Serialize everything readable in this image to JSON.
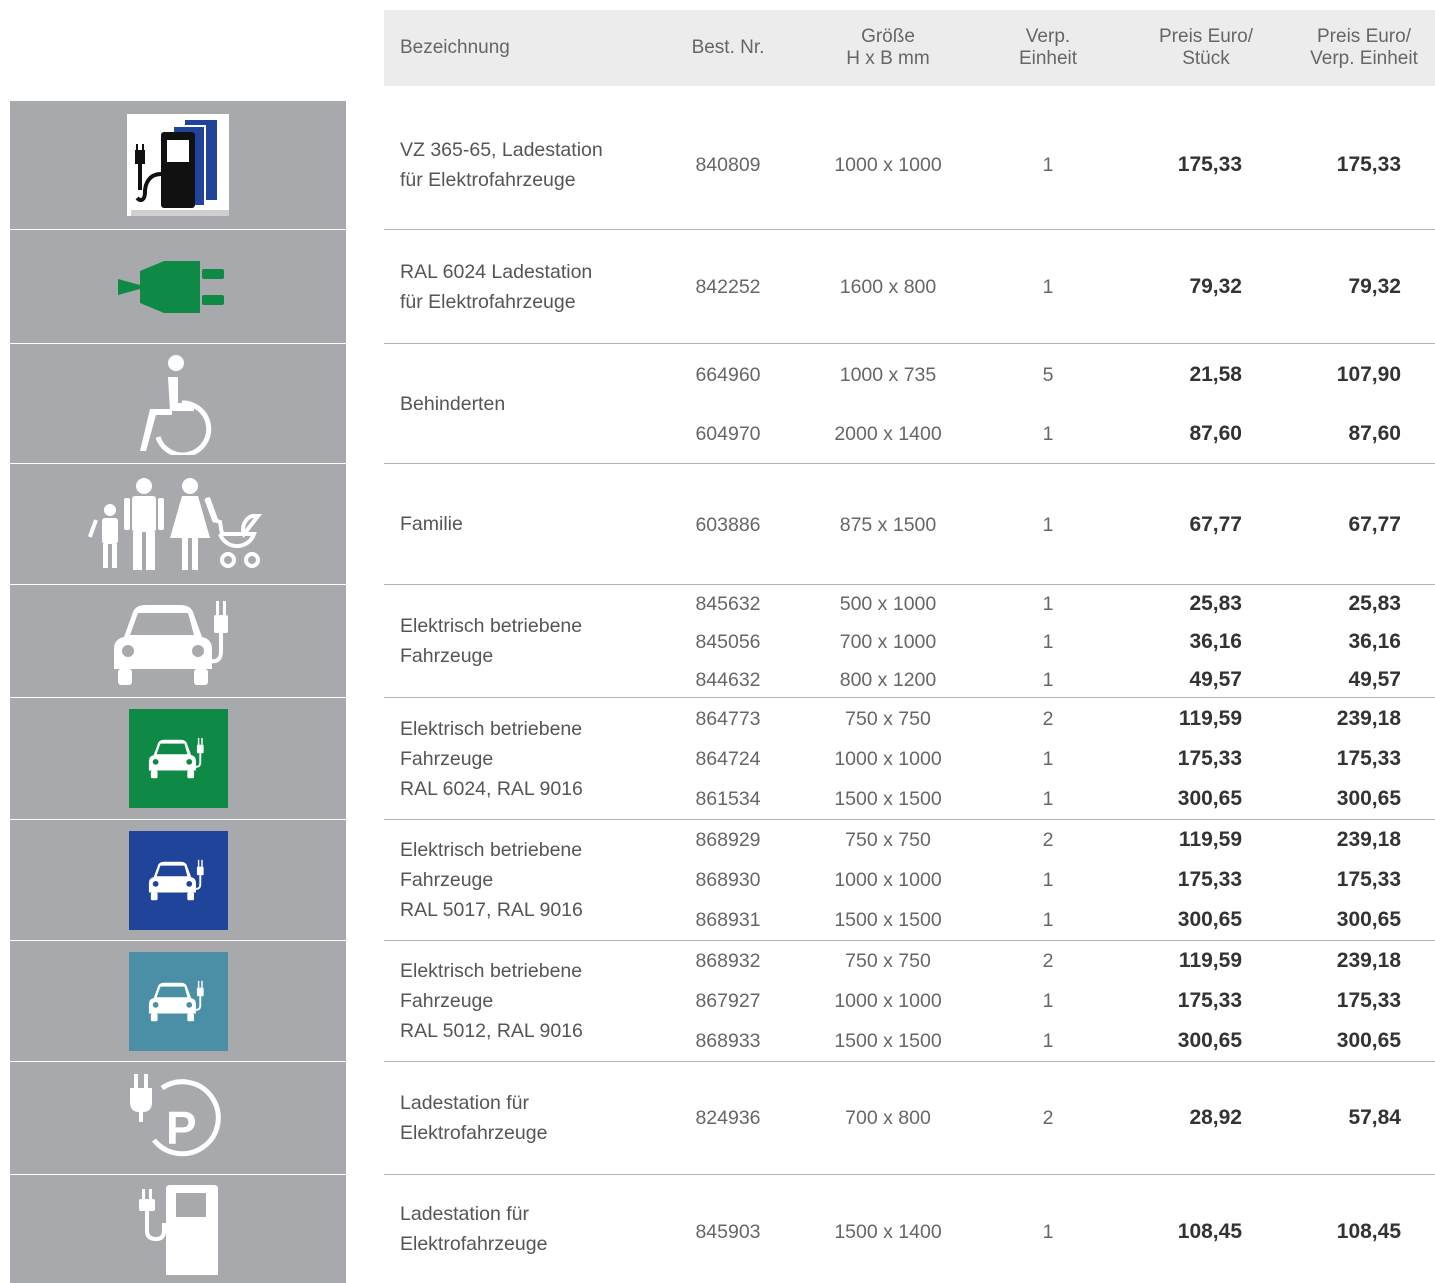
{
  "header": {
    "bezeichnung": "Bezeichnung",
    "best_nr": "Best. Nr.",
    "groesse": "Größe\nH x B mm",
    "verp_einheit": "Verp.\nEinheit",
    "preis_stueck": "Preis Euro/\nStück",
    "preis_verp": "Preis Euro/\nVerp. Einheit"
  },
  "colors": {
    "green": "#0f8a46",
    "blue": "#20449a",
    "teal": "#4a8fa5",
    "icon_bg": "#a7a9ad"
  },
  "groups": [
    {
      "icon": "charging-station-blue-icon",
      "description": "VZ 365-65, Ladestation\nfür Elektrofahrzeuge",
      "rows": [
        {
          "nr": "840809",
          "size": "1000 x 1000",
          "unit": "1",
          "price_piece": "175,33",
          "price_unit": "175,33"
        }
      ]
    },
    {
      "icon": "green-plug-icon",
      "description": "RAL 6024 Ladestation\nfür Elektrofahrzeuge",
      "rows": [
        {
          "nr": "842252",
          "size": "1600 x 800",
          "unit": "1",
          "price_piece": "79,32",
          "price_unit": "79,32"
        }
      ]
    },
    {
      "icon": "wheelchair-icon",
      "description": "Behinderten",
      "rows": [
        {
          "nr": "664960",
          "size": "1000 x 735",
          "unit": "5",
          "price_piece": "21,58",
          "price_unit": "107,90"
        },
        {
          "nr": "604970",
          "size": "2000 x 1400",
          "unit": "1",
          "price_piece": "87,60",
          "price_unit": "87,60"
        }
      ]
    },
    {
      "icon": "family-icon",
      "description": "Familie",
      "rows": [
        {
          "nr": "603886",
          "size": "875 x 1500",
          "unit": "1",
          "price_piece": "67,77",
          "price_unit": "67,77"
        }
      ]
    },
    {
      "icon": "electric-car-icon",
      "description": "Elektrisch betriebene\nFahrzeuge",
      "rows": [
        {
          "nr": "845632",
          "size": "500 x 1000",
          "unit": "1",
          "price_piece": "25,83",
          "price_unit": "25,83"
        },
        {
          "nr": "845056",
          "size": "700 x 1000",
          "unit": "1",
          "price_piece": "36,16",
          "price_unit": "36,16"
        },
        {
          "nr": "844632",
          "size": "800 x 1200",
          "unit": "1",
          "price_piece": "49,57",
          "price_unit": "49,57"
        }
      ]
    },
    {
      "icon": "electric-car-green-sign-icon",
      "description": "Elektrisch betriebene\nFahrzeuge\nRAL 6024, RAL 9016",
      "rows": [
        {
          "nr": "864773",
          "size": "750 x 750",
          "unit": "2",
          "price_piece": "119,59",
          "price_unit": "239,18"
        },
        {
          "nr": "864724",
          "size": "1000 x 1000",
          "unit": "1",
          "price_piece": "175,33",
          "price_unit": "175,33"
        },
        {
          "nr": "861534",
          "size": "1500 x 1500",
          "unit": "1",
          "price_piece": "300,65",
          "price_unit": "300,65"
        }
      ]
    },
    {
      "icon": "electric-car-blue-sign-icon",
      "description": "Elektrisch betriebene\nFahrzeuge\nRAL 5017, RAL 9016",
      "rows": [
        {
          "nr": "868929",
          "size": "750 x 750",
          "unit": "2",
          "price_piece": "119,59",
          "price_unit": "239,18"
        },
        {
          "nr": "868930",
          "size": "1000 x 1000",
          "unit": "1",
          "price_piece": "175,33",
          "price_unit": "175,33"
        },
        {
          "nr": "868931",
          "size": "1500 x 1500",
          "unit": "1",
          "price_piece": "300,65",
          "price_unit": "300,65"
        }
      ]
    },
    {
      "icon": "electric-car-teal-sign-icon",
      "description": "Elektrisch betriebene\nFahrzeuge\nRAL 5012, RAL 9016",
      "rows": [
        {
          "nr": "868932",
          "size": "750 x 750",
          "unit": "2",
          "price_piece": "119,59",
          "price_unit": "239,18"
        },
        {
          "nr": "867927",
          "size": "1000 x 1000",
          "unit": "1",
          "price_piece": "175,33",
          "price_unit": "175,33"
        },
        {
          "nr": "868933",
          "size": "1500 x 1500",
          "unit": "1",
          "price_piece": "300,65",
          "price_unit": "300,65"
        }
      ]
    },
    {
      "icon": "plug-parking-icon",
      "description": "Ladestation für\nElektrofahrzeuge",
      "rows": [
        {
          "nr": "824936",
          "size": "700 x 800",
          "unit": "2",
          "price_piece": "28,92",
          "price_unit": "57,84"
        }
      ]
    },
    {
      "icon": "charging-pump-icon",
      "description": "Ladestation für\nElektrofahrzeuge",
      "rows": [
        {
          "nr": "845903",
          "size": "1500 x 1400",
          "unit": "1",
          "price_piece": "108,45",
          "price_unit": "108,45"
        }
      ]
    }
  ]
}
